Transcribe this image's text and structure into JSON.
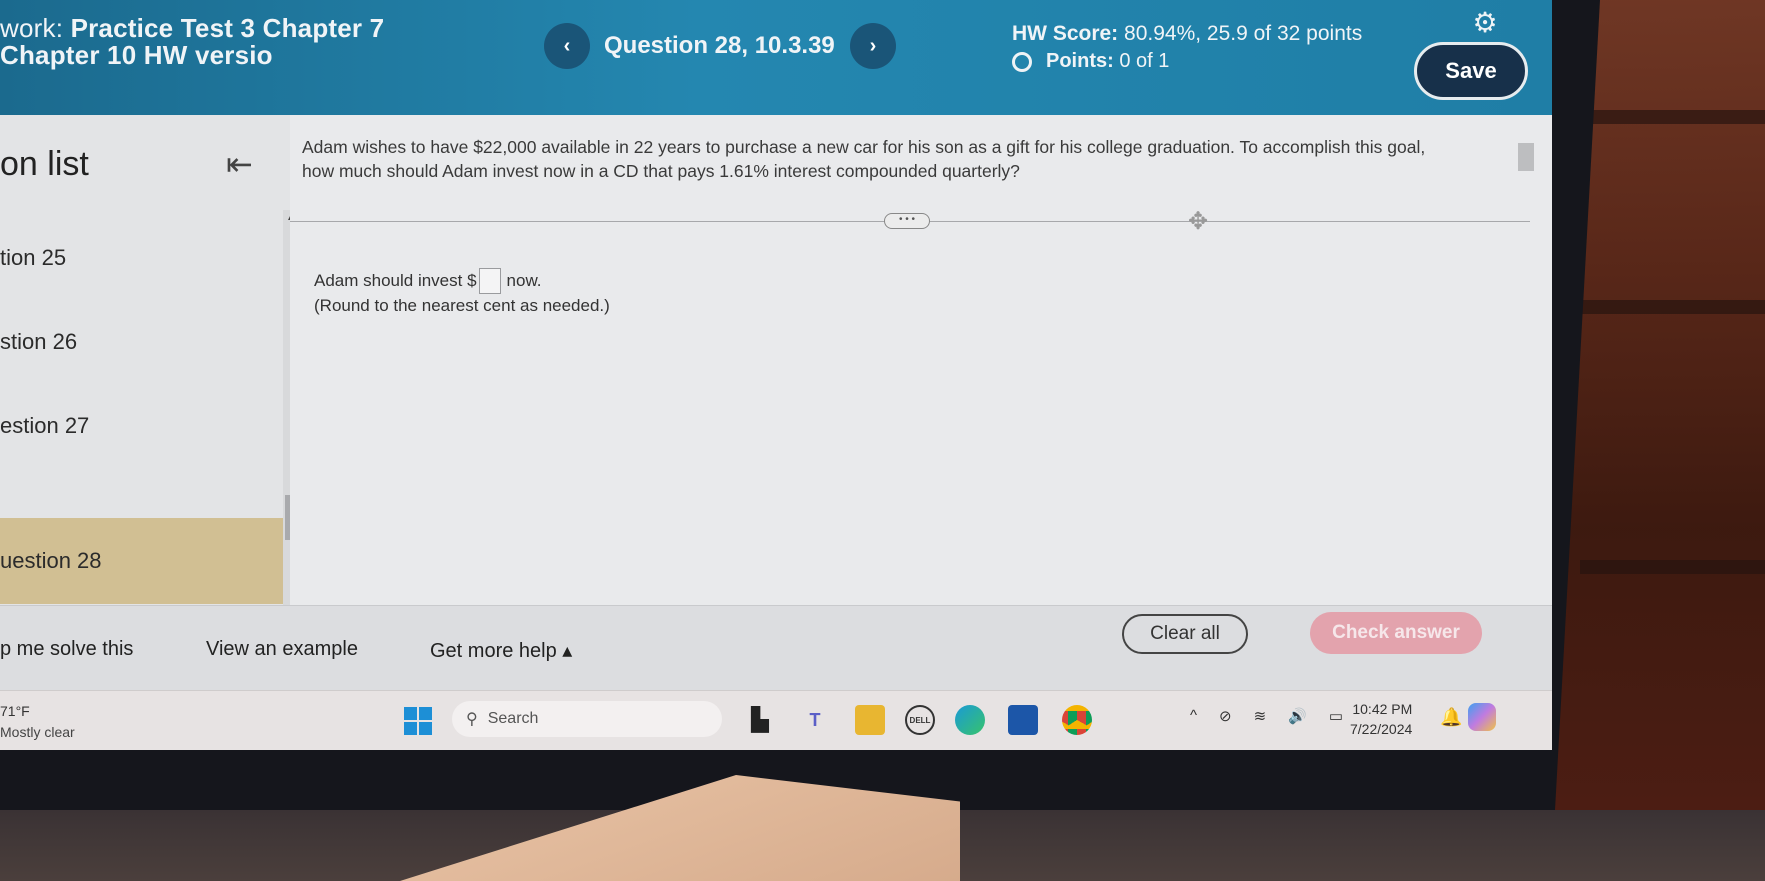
{
  "header": {
    "title_prefix": "work:",
    "title_line1": "Practice Test 3 Chapter 7",
    "title_line2": "Chapter 10 HW versio",
    "prev_label": "‹",
    "next_label": "›",
    "question_label": "Question 28, 10.3.39",
    "hw_score_label": "HW Score:",
    "hw_score_value": "80.94%, 25.9 of 32 points",
    "points_label": "Points:",
    "points_value": "0 of 1",
    "save_label": "Save",
    "gear_glyph": "⚙"
  },
  "sidebar": {
    "title": "on list",
    "collapse_glyph": "⇤",
    "items": [
      {
        "label": "tion 25",
        "active": false
      },
      {
        "label": "stion 26",
        "active": false
      },
      {
        "label": "estion 27",
        "active": false
      },
      {
        "label": "uestion 28",
        "active": true
      }
    ]
  },
  "main": {
    "question_text": "Adam wishes to have $22,000 available in 22 years to purchase a new car for his son as a gift for his college graduation. To accomplish this goal, how much should Adam invest now in a CD that pays 1.61% interest compounded quarterly?",
    "more_glyph": "• • •",
    "move_glyph": "✥",
    "answer_prefix": "Adam should invest $",
    "answer_value": "",
    "answer_suffix": "now.",
    "round_note": "(Round to the nearest cent as needed.)"
  },
  "bottom_bar": {
    "help_me_solve": "p me solve this",
    "view_example": "View an example",
    "get_more_help": "Get more help ▴",
    "clear_all": "Clear all",
    "check_answer": "Check answer"
  },
  "taskbar": {
    "weather_temp": "71°F",
    "weather_desc": "Mostly clear",
    "search_placeholder": "Search",
    "search_glyph": "⚲",
    "apps": [
      {
        "name": "task-view",
        "glyph": "▙",
        "color": "#222"
      },
      {
        "name": "teams",
        "glyph": "T",
        "color": "#5b5fc7"
      },
      {
        "name": "file-explorer",
        "glyph": "▬",
        "color": "#e8b631"
      },
      {
        "name": "dell",
        "glyph": "DELL",
        "color": "#333"
      },
      {
        "name": "edge",
        "glyph": "e",
        "color": "#1a9ad6"
      },
      {
        "name": "microsoft-store",
        "glyph": "▦",
        "color": "#1c56a8"
      },
      {
        "name": "chrome",
        "glyph": "◉",
        "color": "#db4437"
      }
    ],
    "tray": {
      "chevron": "^",
      "mic_off": "⊘",
      "wifi": "≋",
      "volume": "🔊",
      "battery": "▭"
    },
    "time": "10:42 PM",
    "date": "7/22/2024",
    "bell_glyph": "🔔"
  }
}
